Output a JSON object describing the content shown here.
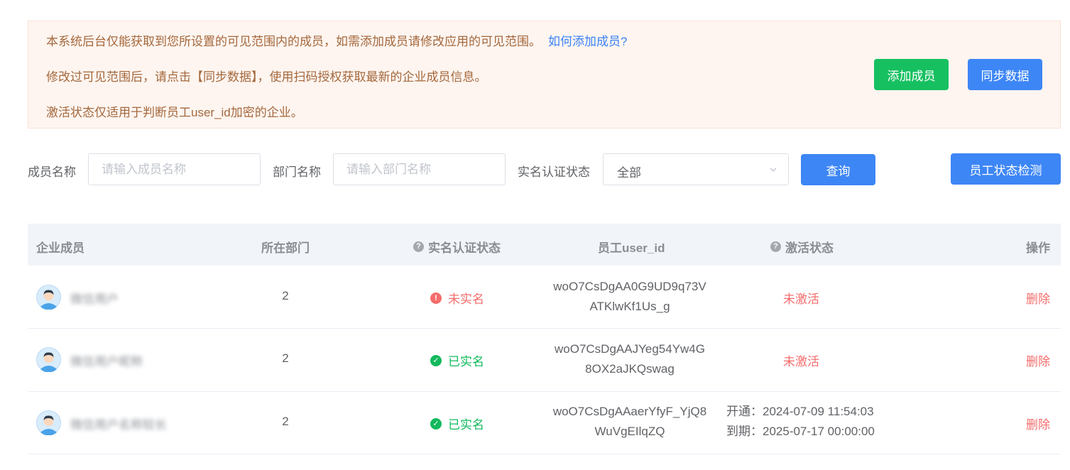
{
  "notice": {
    "line1": "本系统后台仅能获取到您所设置的可见范围内的成员，如需添加成员请修改应用的可见范围。",
    "line1_link": "如何添加成员?",
    "line2": "修改过可见范围后，请点击【同步数据】，使用扫码授权获取最新的企业成员信息。",
    "line3": "激活状态仅适用于判断员工user_id加密的企业。",
    "add_member_label": "添加成员",
    "sync_data_label": "同步数据"
  },
  "filters": {
    "member_name_label": "成员名称",
    "member_name_placeholder": "请输入成员名称",
    "dept_name_label": "部门名称",
    "dept_name_placeholder": "请输入部门名称",
    "verify_status_label": "实名认证状态",
    "verify_status_value": "全部",
    "query_label": "查询",
    "employee_check_label": "员工状态检测"
  },
  "table": {
    "headers": {
      "member": "企业成员",
      "department": "所在部门",
      "verify_status": "实名认证状态",
      "user_id": "员工user_id",
      "activation": "激活状态",
      "operation": "操作"
    },
    "rows": [
      {
        "name": "微信用户",
        "department": "2",
        "verify_status": "未实名",
        "user_id_line1": "woO7CsDgAA0G9UD9q73V",
        "user_id_line2": "ATKlwKf1Us_g",
        "activation": "未激活",
        "operation": "删除"
      },
      {
        "name": "微信用户昵称",
        "department": "2",
        "verify_status": "已实名",
        "user_id_line1": "woO7CsDgAAJYeg54Yw4G",
        "user_id_line2": "8OX2aJKQswag",
        "activation": "未激活",
        "operation": "删除"
      },
      {
        "name": "微信用户名称较长",
        "department": "2",
        "verify_status": "已实名",
        "user_id_line1": "woO7CsDgAAaerYfyF_YjQ8",
        "user_id_line2": "WuVgEIlqZQ",
        "activation_open": "开通：2024-07-09 11:54:03",
        "activation_expire": "到期：2025-07-17 00:00:00",
        "operation": "删除"
      }
    ]
  },
  "colors": {
    "green_button": "#16c060",
    "blue_button": "#3d86f5",
    "notice_bg": "#fef5f0",
    "notice_text": "#a4683c",
    "danger": "#f56c6c",
    "success": "#13b95c"
  }
}
